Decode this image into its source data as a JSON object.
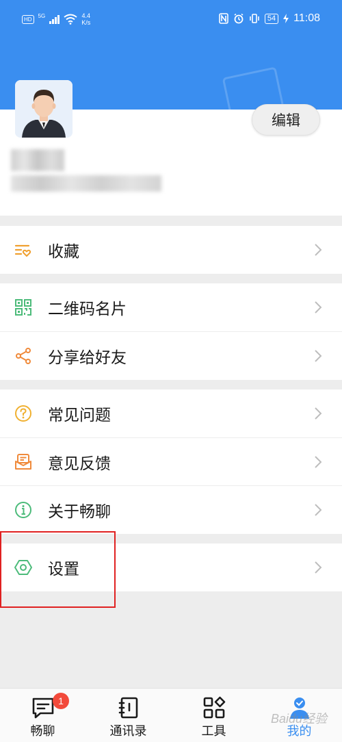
{
  "status_bar": {
    "hd_label": "HD",
    "network_label": "5G",
    "speed_value": "4.4",
    "speed_unit": "K/s",
    "battery": "54",
    "time": "11:08"
  },
  "profile": {
    "edit_label": "编辑"
  },
  "menu": {
    "favorites": "收藏",
    "qr_card": "二维码名片",
    "share": "分享给好友",
    "faq": "常见问题",
    "feedback": "意见反馈",
    "about": "关于畅聊",
    "settings": "设置"
  },
  "tabbar": {
    "chat": "畅聊",
    "chat_badge": "1",
    "contacts": "通讯录",
    "tools": "工具",
    "me": "我的",
    "watermark": "Baidu经验"
  },
  "colors": {
    "header_blue": "#3a8ef0",
    "icon_orange": "#f0a030",
    "icon_green": "#4cbb7a",
    "badge_red": "#f24a3b",
    "highlight_red": "#e02020"
  },
  "icons": {
    "favorites": "favorite-list-icon",
    "qr_card": "qr-code-icon",
    "share": "share-icon",
    "faq": "question-icon",
    "feedback": "feedback-icon",
    "about": "info-icon",
    "settings": "hexagon-settings-icon"
  }
}
